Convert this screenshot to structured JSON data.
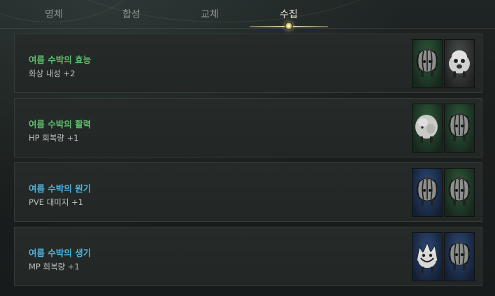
{
  "tabs": [
    {
      "label": "영체",
      "active": false
    },
    {
      "label": "합성",
      "active": false
    },
    {
      "label": "교체",
      "active": false
    },
    {
      "label": "수집",
      "active": true
    }
  ],
  "collections": [
    {
      "title": "여름 수박의 효능",
      "title_color": "#5fbf6d",
      "desc": "화상 내성 +2",
      "cards": [
        {
          "bg": "green",
          "creature": "watermelon-creature-icon"
        },
        {
          "bg": "gray",
          "creature": "ghost-creature-icon"
        }
      ]
    },
    {
      "title": "여름 수박의 활력",
      "title_color": "#5fbf6d",
      "desc": "HP 회복량 +1",
      "cards": [
        {
          "bg": "green",
          "creature": "fluffy-creature-icon"
        },
        {
          "bg": "green",
          "creature": "watermelon-creature-icon"
        }
      ]
    },
    {
      "title": "여름 수박의 원기",
      "title_color": "#4fb4df",
      "desc": "PVE 대미지 +1",
      "cards": [
        {
          "bg": "blue",
          "creature": "watermelon-creature-icon"
        },
        {
          "bg": "green",
          "creature": "watermelon-creature-icon"
        }
      ]
    },
    {
      "title": "여름 수박의 생기",
      "title_color": "#4fb4df",
      "desc": "MP 회복량 +1",
      "cards": [
        {
          "bg": "blue",
          "creature": "spiky-creature-icon"
        },
        {
          "bg": "blue",
          "creature": "watermelon-creature-icon"
        }
      ]
    }
  ]
}
